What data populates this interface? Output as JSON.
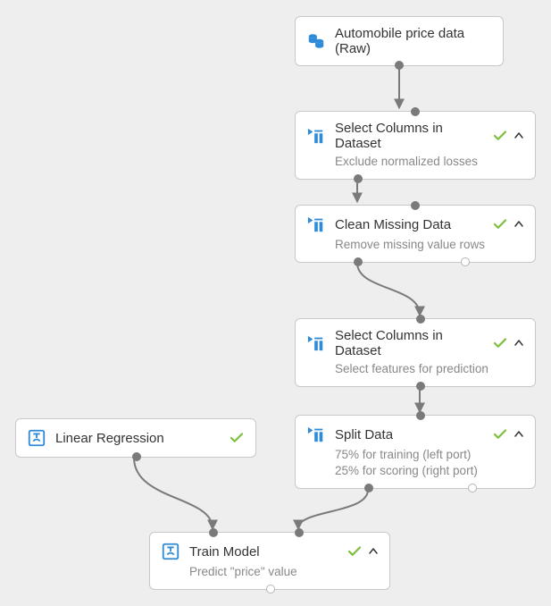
{
  "nodes": [
    {
      "id": "n1",
      "title": "Automobile price data (Raw)"
    },
    {
      "id": "n2",
      "title": "Select Columns in Dataset",
      "subtitle": "Exclude normalized losses"
    },
    {
      "id": "n3",
      "title": "Clean Missing Data",
      "subtitle": "Remove missing value rows"
    },
    {
      "id": "n4",
      "title": "Select Columns in Dataset",
      "subtitle": "Select features for prediction"
    },
    {
      "id": "n5",
      "title": "Split Data",
      "subtitle": "75% for training (left port)",
      "subtitle2": "25% for scoring (right port)"
    },
    {
      "id": "n6",
      "title": "Linear Regression"
    },
    {
      "id": "n7",
      "title": "Train Model",
      "subtitle": "Predict \"price\" value"
    }
  ],
  "edges": [
    {
      "from": "n1",
      "to": "n2"
    },
    {
      "from": "n2",
      "to": "n3"
    },
    {
      "from": "n3",
      "to": "n4"
    },
    {
      "from": "n4",
      "to": "n5"
    },
    {
      "from": "n5",
      "to": "n7",
      "fromPort": "left"
    },
    {
      "from": "n6",
      "to": "n7"
    }
  ],
  "colors": {
    "accent": "#2e8bd8",
    "success": "#7fbf3f",
    "border": "#c8c8c8",
    "bg": "#eeeeee"
  }
}
